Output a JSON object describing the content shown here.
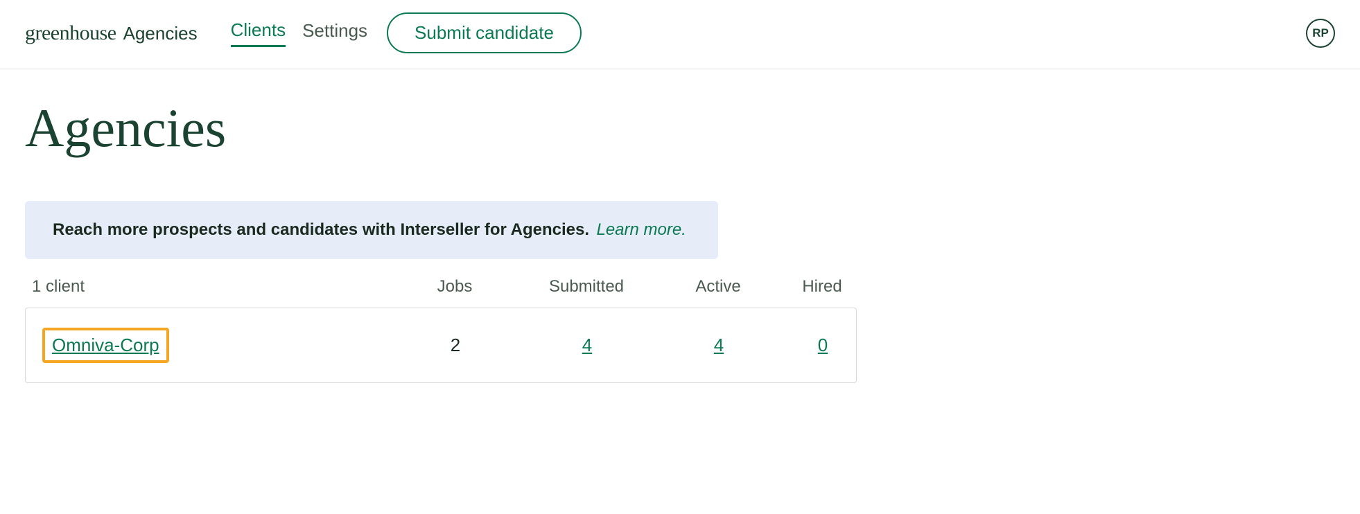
{
  "header": {
    "brand_main": "greenhouse",
    "brand_sub": "Agencies",
    "nav": {
      "clients": "Clients",
      "settings": "Settings"
    },
    "submit_label": "Submit candidate",
    "avatar_initials": "RP"
  },
  "page": {
    "title": "Agencies"
  },
  "banner": {
    "text": "Reach more prospects and candidates with Interseller for Agencies.",
    "link": "Learn more."
  },
  "table": {
    "count_label": "1 client",
    "columns": {
      "jobs": "Jobs",
      "submitted": "Submitted",
      "active": "Active",
      "hired": "Hired"
    },
    "rows": [
      {
        "name": "Omniva-Corp",
        "jobs": "2",
        "submitted": "4",
        "active": "4",
        "hired": "0"
      }
    ]
  }
}
